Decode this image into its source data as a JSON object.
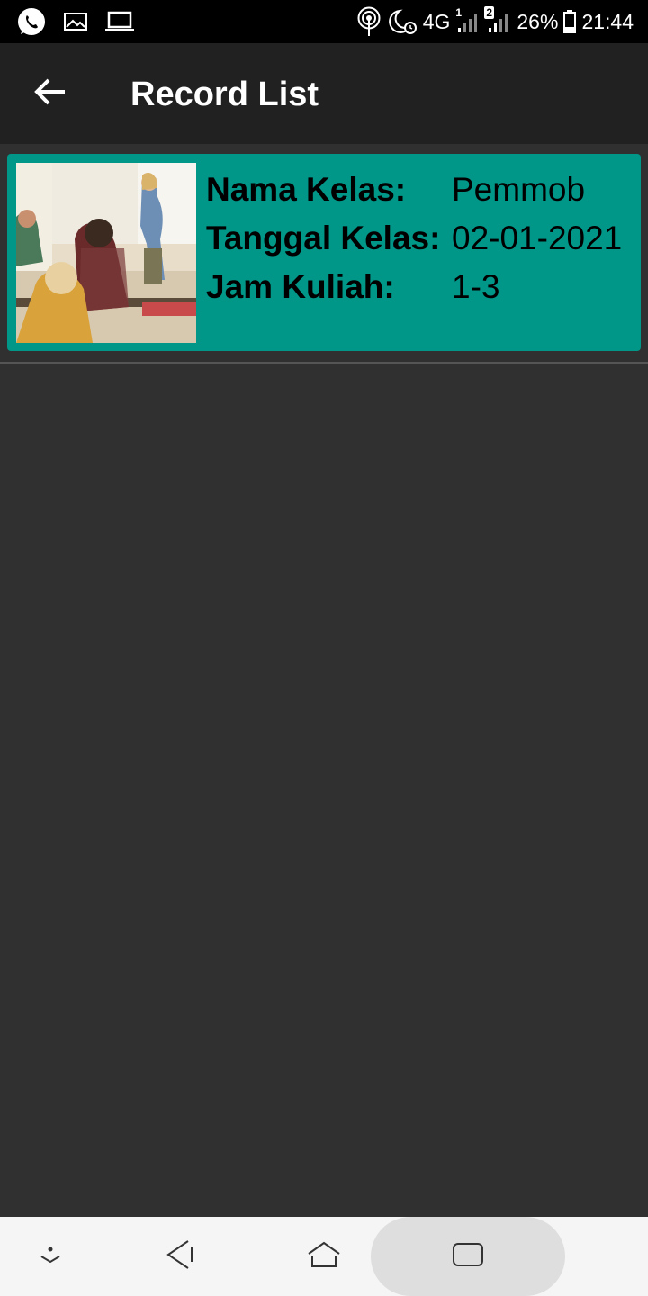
{
  "status_bar": {
    "battery": "26%",
    "time": "21:44",
    "network": "4G",
    "sim1": "1",
    "sim2": "2",
    "icons_left": [
      "whatsapp-icon",
      "gallery-icon",
      "laptop-icon"
    ],
    "icons_right": [
      "hotspot-icon",
      "night-alarm-icon",
      "signal-icon",
      "battery-icon"
    ]
  },
  "app_bar": {
    "title": "Record List",
    "back_icon": "arrow-back-icon"
  },
  "records": [
    {
      "image": "classroom-photo",
      "fields": [
        {
          "label": "Nama Kelas:",
          "value": "Pemmob"
        },
        {
          "label": "Tanggal Kelas:",
          "value": "02-01-2021"
        },
        {
          "label": "Jam Kuliah:",
          "value": "1-3"
        }
      ]
    }
  ],
  "colors": {
    "background": "#303030",
    "app_bar": "#212121",
    "card": "#009688",
    "nav_bar": "#f5f5f5"
  },
  "nav_bar": {
    "buttons": [
      "dropdown-icon",
      "back-icon",
      "home-icon",
      "recents-icon"
    ]
  }
}
